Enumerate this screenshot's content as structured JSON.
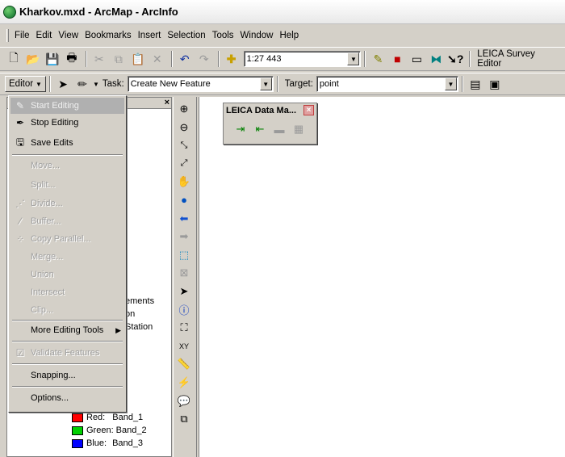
{
  "window": {
    "title": "Kharkov.mxd - ArcMap - ArcInfo"
  },
  "menubar": [
    "File",
    "Edit",
    "View",
    "Bookmarks",
    "Insert",
    "Selection",
    "Tools",
    "Window",
    "Help"
  ],
  "standard_toolbar": {
    "scale_value": "1:27 443",
    "leica_survey_editor_label": "LEICA Survey Editor"
  },
  "editor_toolbar": {
    "editor_button": "Editor",
    "task_label": "Task:",
    "task_value": "Create New Feature",
    "target_label": "Target:",
    "target_value": "point"
  },
  "editor_menu": {
    "items": [
      {
        "label": "Start Editing",
        "icon": "pencil-icon",
        "state": "highlighted-disabled"
      },
      {
        "label": "Stop Editing",
        "icon": "stop-edit-icon",
        "state": "enabled"
      },
      {
        "label": "Save Edits",
        "icon": "save-edits-icon",
        "state": "enabled"
      },
      {
        "label": "Move...",
        "state": "disabled"
      },
      {
        "label": "Split...",
        "state": "disabled"
      },
      {
        "label": "Divide...",
        "icon": "divide-icon",
        "state": "disabled"
      },
      {
        "label": "Buffer...",
        "icon": "buffer-icon",
        "state": "disabled"
      },
      {
        "label": "Copy Parallel...",
        "icon": "copy-parallel-icon",
        "state": "disabled"
      },
      {
        "label": "Merge...",
        "state": "disabled"
      },
      {
        "label": "Union",
        "state": "disabled"
      },
      {
        "label": "Intersect",
        "state": "disabled"
      },
      {
        "label": "Clip...",
        "state": "disabled"
      },
      {
        "label": "More Editing Tools",
        "state": "enabled",
        "submenu": true
      },
      {
        "label": "Validate Features",
        "icon": "validate-icon",
        "state": "disabled"
      },
      {
        "label": "Snapping...",
        "state": "enabled"
      },
      {
        "label": "Options...",
        "state": "enabled"
      }
    ]
  },
  "toc": {
    "partial_texts": [
      "ements",
      "on",
      "Station"
    ],
    "legend": [
      {
        "label": "Red:",
        "band": "Band_1",
        "color": "#ff0000"
      },
      {
        "label": "Green:",
        "band": "Band_2",
        "color": "#00c000"
      },
      {
        "label": "Blue:",
        "band": "Band_3",
        "color": "#0000ff"
      }
    ]
  },
  "leica_window": {
    "title": "LEICA Data Ma..."
  }
}
